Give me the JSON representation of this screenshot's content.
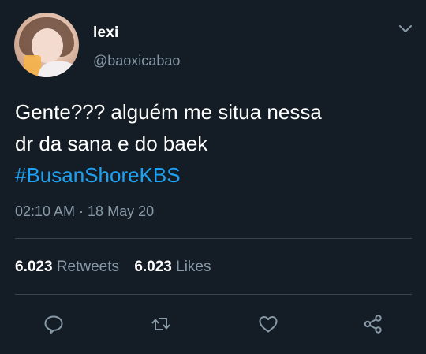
{
  "user": {
    "name": "lexi",
    "handle": "@baoxicabao"
  },
  "tweet": {
    "line1": "Gente??? alguém me situa nessa",
    "line2": "dr da sana e do baek",
    "hashtag": "#BusanShoreKBS",
    "timestamp": "02:10 AM · 18 May 20"
  },
  "stats": {
    "retweets_count": "6.023",
    "retweets_label": "Retweets",
    "likes_count": "6.023",
    "likes_label": "Likes"
  },
  "icons": {
    "more": "chevron-down-icon",
    "reply": "reply-icon",
    "retweet": "retweet-icon",
    "like": "heart-icon",
    "share": "share-icon"
  },
  "colors": {
    "background": "#141d26",
    "accent": "#1da1f2",
    "muted": "#8899a6",
    "divider": "#38444d"
  }
}
